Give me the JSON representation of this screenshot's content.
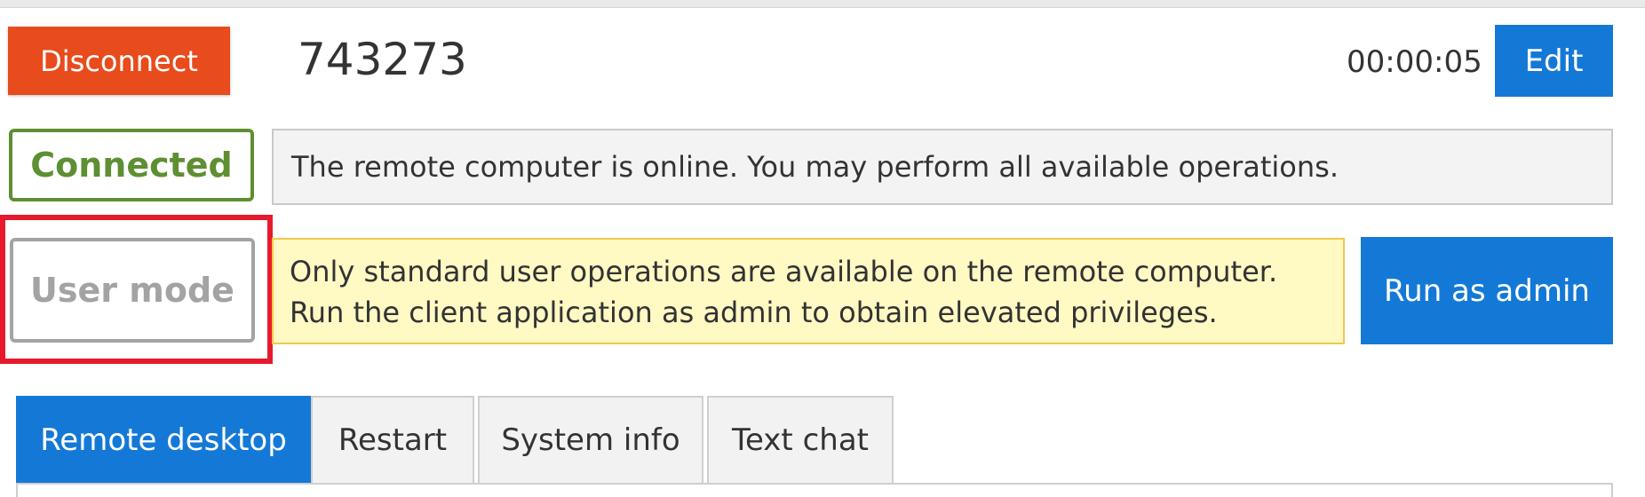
{
  "header": {
    "disconnect_label": "Disconnect",
    "session_id": "743273",
    "timer": "00:00:05",
    "edit_label": "Edit"
  },
  "connection_status": {
    "badge": "Connected",
    "message": "The remote computer is online. You may perform all available operations."
  },
  "privilege_status": {
    "badge": "User mode",
    "message": "Only standard user operations are available on the remote computer. Run the client application as admin to obtain elevated privileges.",
    "action_label": "Run as admin"
  },
  "tabs": [
    {
      "label": "Remote desktop",
      "active": true
    },
    {
      "label": "Restart",
      "active": false
    },
    {
      "label": "System info",
      "active": false
    },
    {
      "label": "Text chat",
      "active": false
    }
  ],
  "colors": {
    "disconnect": "#e84b1c",
    "primary": "#1479d6",
    "connected": "#5e8f33",
    "inactive": "#a3a3a3",
    "warning_bg": "#fff9c4",
    "warning_border": "#f2c94c",
    "highlight": "#e8192c"
  }
}
